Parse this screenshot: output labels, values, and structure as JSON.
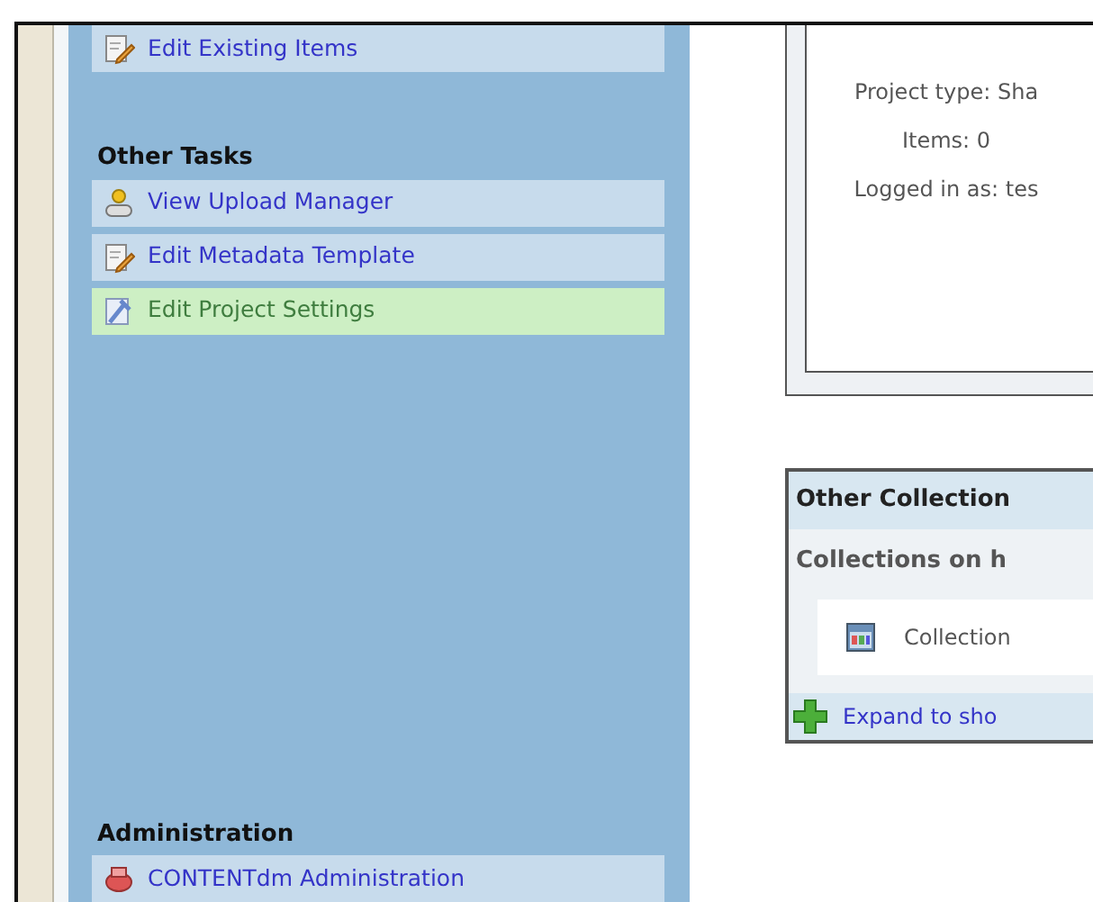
{
  "sidebar": {
    "sections": [
      {
        "items": [
          {
            "label": "Edit Existing Items",
            "kind": "edit",
            "selected": false
          }
        ]
      },
      {
        "heading": "Other Tasks",
        "items": [
          {
            "label": "View Upload Manager",
            "kind": "upload",
            "selected": false
          },
          {
            "label": "Edit Metadata Template",
            "kind": "edit",
            "selected": false
          },
          {
            "label": "Edit Project Settings",
            "kind": "settings",
            "selected": true
          }
        ]
      },
      {
        "heading": "Administration",
        "items": [
          {
            "label": "CONTENTdm Administration",
            "kind": "admin",
            "selected": false
          }
        ]
      }
    ]
  },
  "project_info": {
    "lines": [
      "Project type: Sha",
      "Items: 0",
      "Logged in as: tes"
    ]
  },
  "other_collections": {
    "title": "Other Collection",
    "subtitle": "Collections on h",
    "collections": [
      {
        "label": "Collection"
      }
    ],
    "expand_link": "Expand to sho"
  }
}
